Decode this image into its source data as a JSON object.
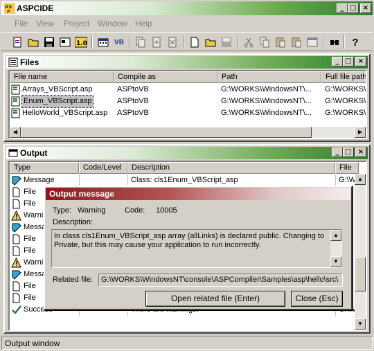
{
  "app": {
    "title": "ASPCIDE"
  },
  "menu": {
    "items": [
      "File",
      "View",
      "Project",
      "Window",
      "Help"
    ]
  },
  "toolbar": {
    "icons": [
      "new-file-icon",
      "open-folder-icon",
      "save-icon",
      "project-icon",
      "compile-icon",
      "calendar-icon",
      "vb-icon",
      "copy-doc-icon",
      "doc-add-icon",
      "doc-remove-icon",
      "new-doc-icon",
      "open-doc-icon",
      "save-doc-icon",
      "cut-icon",
      "copy-icon",
      "paste-icon",
      "paste-special-icon",
      "window-icon",
      "find-icon",
      "help-icon"
    ],
    "vb_label": "VB"
  },
  "files_window": {
    "title": "Files",
    "columns": [
      "File name",
      "Compile as",
      "Path",
      "Full file path"
    ],
    "rows": [
      {
        "name": "Arrays_VBScript.asp",
        "compile": "ASPtoVB",
        "path": "G:\\WORKS\\WindowsNT\\...",
        "full": "G:\\WORKS\\"
      },
      {
        "name": "Enum_VBScript.asp",
        "compile": "ASPtoVB",
        "path": "G:\\WORKS\\WindowsNT\\...",
        "full": "G:\\WORKS\\"
      },
      {
        "name": "HelloWorld_VBScript.asp",
        "compile": "ASPtoVB",
        "path": "G:\\WORKS\\WindowsNT\\...",
        "full": "G:\\WORKS\\"
      }
    ]
  },
  "output_window": {
    "title": "Output",
    "columns": [
      "Type",
      "Code/Level",
      "Description",
      "File"
    ],
    "rows": [
      {
        "type": "Message",
        "code": "",
        "desc": "Class: cls1Enum_VBScript_asp",
        "file": "G:\\W",
        "icon": "message"
      },
      {
        "type": "File",
        "code": "",
        "desc": "",
        "file": "",
        "icon": "file"
      },
      {
        "type": "File",
        "code": "",
        "desc": "",
        "file": "",
        "icon": "file"
      },
      {
        "type": "Warni",
        "code": "",
        "desc": "",
        "file": "",
        "icon": "warning"
      },
      {
        "type": "Messa",
        "code": "",
        "desc": "",
        "file": "",
        "icon": "message"
      },
      {
        "type": "File",
        "code": "",
        "desc": "",
        "file": "",
        "icon": "file"
      },
      {
        "type": "File",
        "code": "",
        "desc": "",
        "file": "",
        "icon": "file"
      },
      {
        "type": "Warni",
        "code": "",
        "desc": "",
        "file": "",
        "icon": "warning"
      },
      {
        "type": "Messa",
        "code": "",
        "desc": "",
        "file": "",
        "icon": "message"
      },
      {
        "type": "File",
        "code": "",
        "desc": "",
        "file": "",
        "icon": "file"
      },
      {
        "type": "File",
        "code": "",
        "desc": "",
        "file": "",
        "icon": "file"
      },
      {
        "type": "Success",
        "code": "",
        "desc": "There are warnings.",
        "file": "G:\\W",
        "icon": "check"
      }
    ]
  },
  "dialog": {
    "title": "Output message",
    "type_label": "Type:",
    "type_value": "Warning",
    "code_label": "Code:",
    "code_value": "10005",
    "description_label": "Description:",
    "description_text": "In class cls1Enum_VBScript_asp array (allLinks) is declared public. Changing to Private, but this may cause your application to run incorrectly.",
    "related_label": "Related file:",
    "related_value": "G:\\WORKS\\WindowsNT\\console\\ASPCompiler\\Samples\\asp\\hello\\src\\",
    "open_button": "Open related file (Enter)",
    "close_button": "Close (Esc)"
  },
  "status": {
    "text": "Output window"
  },
  "window_controls": {
    "minimize": "_",
    "maximize": "□",
    "close": "×"
  }
}
